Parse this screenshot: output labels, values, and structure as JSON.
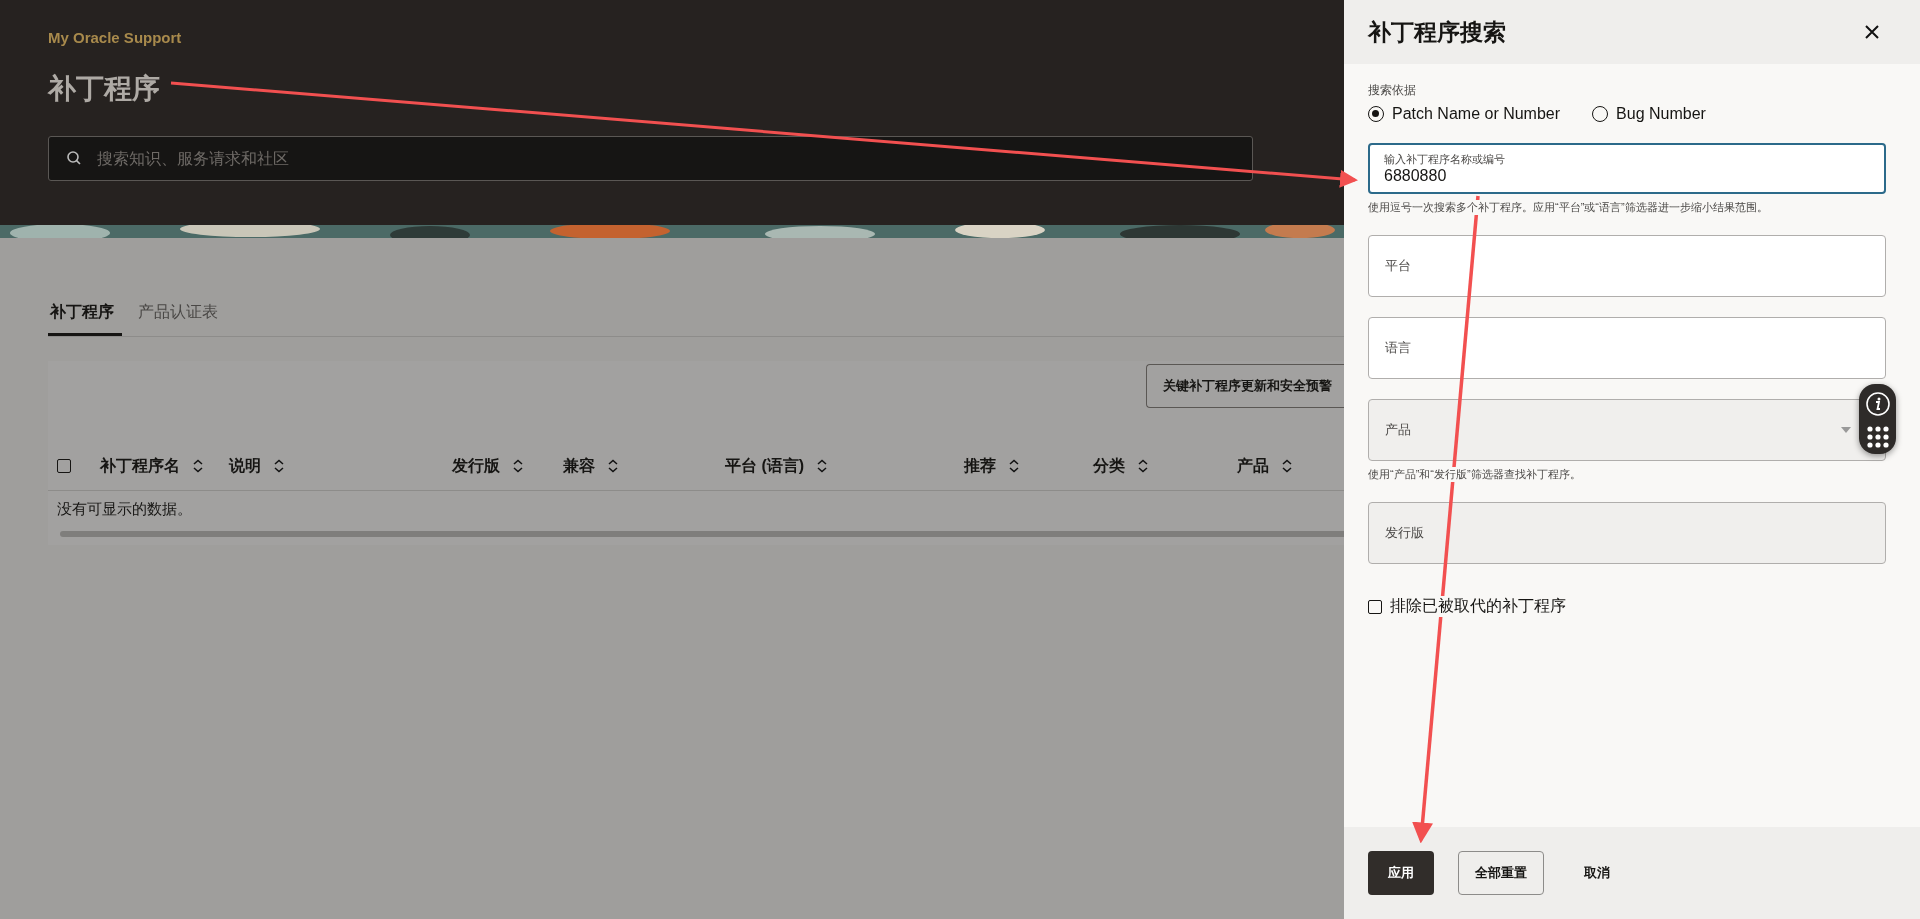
{
  "header": {
    "brand": "My Oracle Support",
    "title": "补丁程序",
    "search": {
      "placeholder": "搜索知识、服务请求和社区"
    }
  },
  "tabs": [
    {
      "label": "补丁程序",
      "selected": true
    },
    {
      "label": "产品认证表",
      "selected": false
    }
  ],
  "toolbar": {
    "button": "关键补丁程序更新和安全预警"
  },
  "table": {
    "select_all_checked": false,
    "columns": [
      {
        "label": "补丁程序名"
      },
      {
        "label": "说明"
      },
      {
        "label": "发行版"
      },
      {
        "label": "兼容"
      },
      {
        "label": "平台 (语言)"
      },
      {
        "label": "推荐"
      },
      {
        "label": "分类"
      },
      {
        "label": "产品"
      }
    ],
    "empty_message": "没有可显示的数据。"
  },
  "panel": {
    "title": "补丁程序搜索",
    "search_by": {
      "label": "搜索依据",
      "options": [
        {
          "label": "Patch Name or Number",
          "selected": true
        },
        {
          "label": "Bug Number",
          "selected": false
        }
      ]
    },
    "fields": [
      {
        "label": "输入补丁程序名称或编号",
        "value": "6880880",
        "focused": true,
        "disabled": false,
        "dropdown": false,
        "help": "使用逗号一次搜索多个补丁程序。应用“平台”或“语言”筛选器进一步缩小结果范围。"
      },
      {
        "label": "平台",
        "focused": false,
        "disabled": false,
        "dropdown": false
      },
      {
        "label": "语言",
        "focused": false,
        "disabled": false,
        "dropdown": false
      },
      {
        "label": "产品",
        "focused": false,
        "disabled": true,
        "dropdown": true,
        "help": "使用“产品”和“发行版”筛选器查找补丁程序。"
      },
      {
        "label": "发行版",
        "focused": false,
        "disabled": true,
        "dropdown": false
      }
    ],
    "exclude_checkbox": {
      "label": "排除已被取代的补丁程序",
      "checked": false
    },
    "buttons": [
      {
        "label": "应用",
        "kind": "primary"
      },
      {
        "label": "全部重置",
        "kind": "outline"
      },
      {
        "label": "取消",
        "kind": "text"
      }
    ]
  }
}
